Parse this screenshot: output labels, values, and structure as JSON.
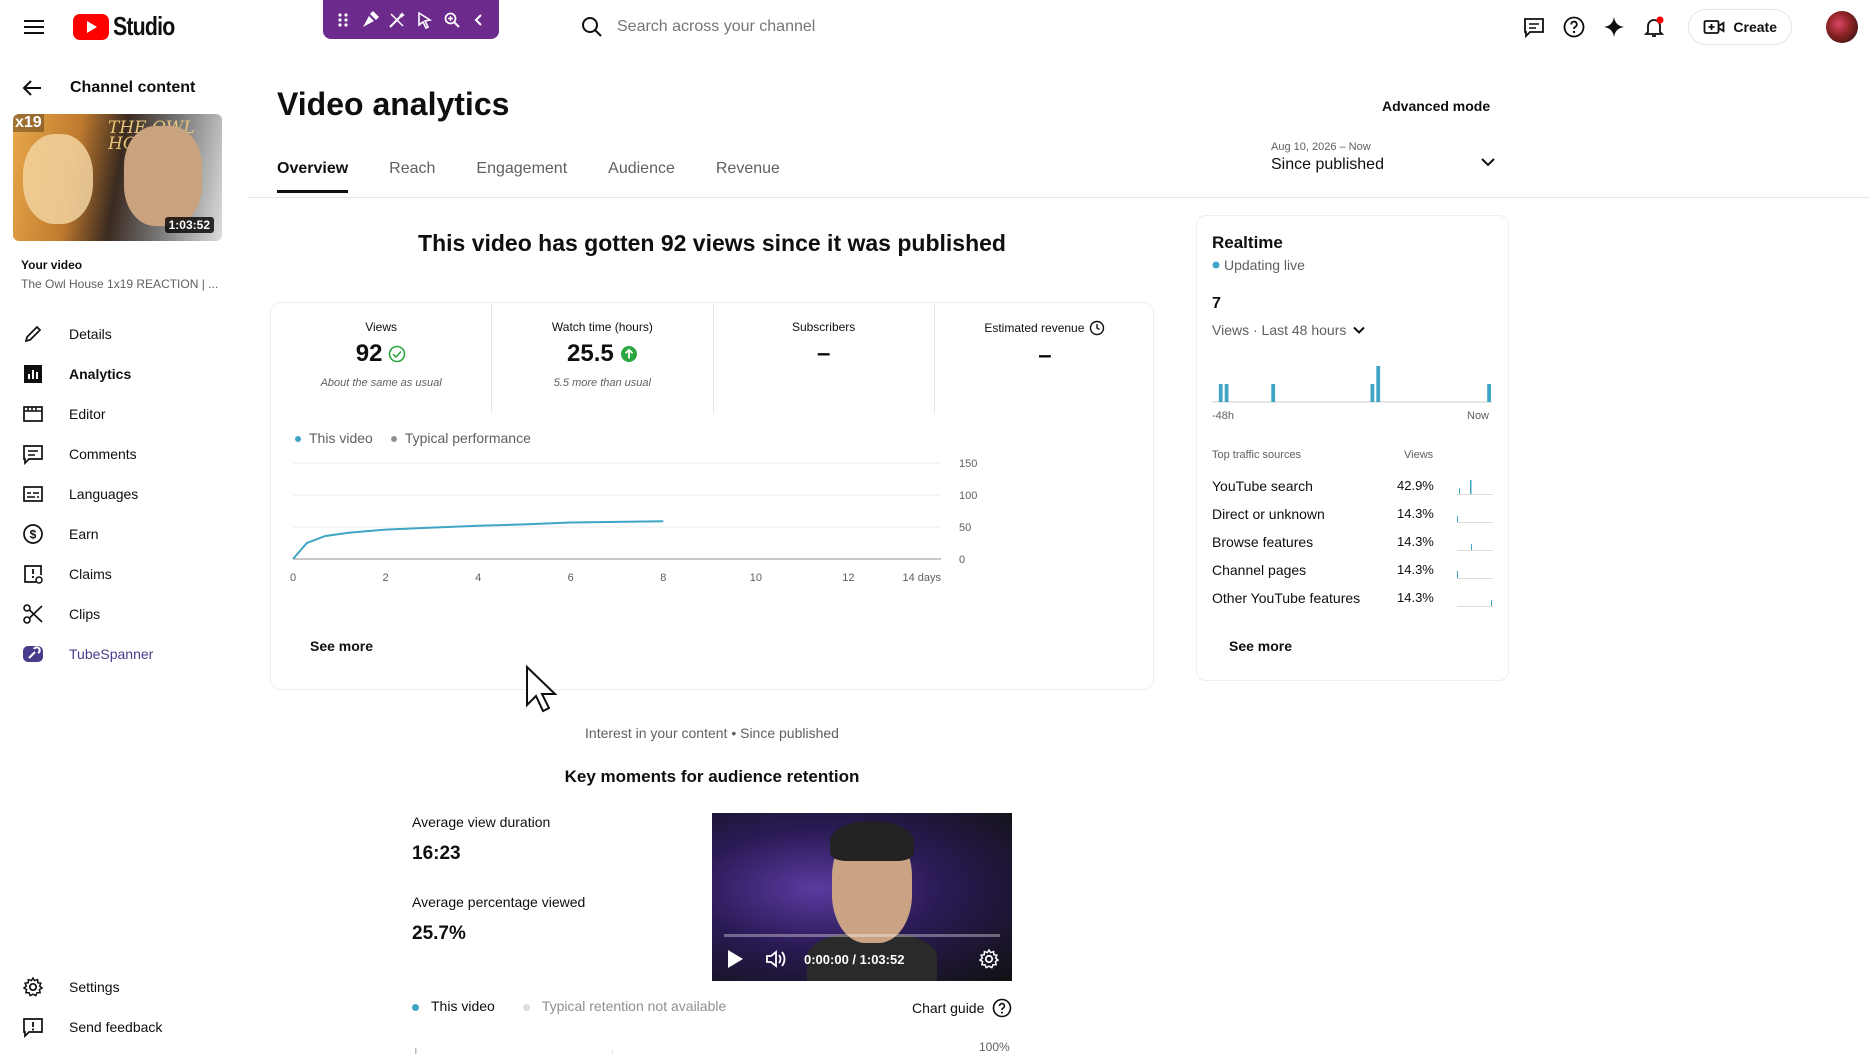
{
  "header": {
    "app_name": "Studio",
    "search_placeholder": "Search across your channel",
    "create_label": "Create"
  },
  "sidebar": {
    "back_label": "Channel content",
    "thumbnail": {
      "episode_badge": "x19",
      "duration": "1:03:52",
      "art_text": "THE OWL HOUSE"
    },
    "your_video_label": "Your video",
    "video_title": "The Owl House 1x19 REACTION | ...",
    "items": [
      {
        "label": "Details",
        "icon": "pencil-icon"
      },
      {
        "label": "Analytics",
        "icon": "analytics-icon"
      },
      {
        "label": "Editor",
        "icon": "editor-icon"
      },
      {
        "label": "Comments",
        "icon": "comments-icon"
      },
      {
        "label": "Languages",
        "icon": "subtitles-icon"
      },
      {
        "label": "Earn",
        "icon": "dollar-icon"
      },
      {
        "label": "Claims",
        "icon": "claims-icon"
      },
      {
        "label": "Clips",
        "icon": "scissors-icon"
      },
      {
        "label": "TubeSpanner",
        "icon": "tubespanner-icon"
      }
    ],
    "bottom_items": [
      {
        "label": "Settings",
        "icon": "gear-icon"
      },
      {
        "label": "Send feedback",
        "icon": "feedback-icon"
      }
    ]
  },
  "main": {
    "title": "Video analytics",
    "advanced_mode": "Advanced mode",
    "tabs": [
      "Overview",
      "Reach",
      "Engagement",
      "Audience",
      "Revenue"
    ],
    "date_range": "Aug 10, 2026 – Now",
    "date_value": "Since published",
    "headline": "This video has gotten 92 views since it was published",
    "metrics": [
      {
        "label": "Views",
        "value": "92",
        "sub": "About the same as usual",
        "status": "same"
      },
      {
        "label": "Watch time (hours)",
        "value": "25.5",
        "sub": "5.5 more than usual",
        "status": "up"
      },
      {
        "label": "Subscribers",
        "value": "–",
        "sub": "",
        "status": "none"
      },
      {
        "label": "Estimated revenue",
        "value": "–",
        "sub": "",
        "status": "none"
      }
    ],
    "legend": {
      "this_video": "This video",
      "typical": "Typical performance"
    },
    "see_more": "See more"
  },
  "chart_data": {
    "type": "line",
    "series": [
      {
        "name": "This video",
        "color": "#3ea6c4",
        "x": [
          0,
          0.3,
          0.7,
          1.2,
          2,
          3,
          4,
          5,
          6,
          7,
          8
        ],
        "y": [
          0,
          25,
          36,
          41,
          46,
          49,
          52,
          54,
          57,
          58,
          59
        ]
      }
    ],
    "xticks": [
      "0",
      "2",
      "4",
      "6",
      "8",
      "10",
      "12",
      "14 days"
    ],
    "yticks": [
      "150",
      "100",
      "50",
      "0"
    ],
    "xlim": [
      0,
      14
    ],
    "ylim": [
      0,
      150
    ],
    "grid": true
  },
  "realtime": {
    "title": "Realtime",
    "live_label": "Updating live",
    "count": "7",
    "period": "Views · Last 48 hours",
    "axis_start": "-48h",
    "axis_end": "Now",
    "bars_hourly": [
      0,
      2,
      2,
      0,
      0,
      0,
      0,
      0,
      0,
      0,
      2,
      0,
      0,
      0,
      0,
      0,
      0,
      0,
      0,
      0,
      0,
      0,
      0,
      0,
      0,
      0,
      0,
      2,
      4,
      0,
      0,
      0,
      0,
      0,
      0,
      0,
      0,
      0,
      0,
      0,
      0,
      0,
      0,
      0,
      0,
      0,
      0,
      2
    ],
    "sources_title": "Top traffic sources",
    "views_col": "Views",
    "sources": [
      {
        "name": "YouTube search",
        "pct": "42.9%"
      },
      {
        "name": "Direct or unknown",
        "pct": "14.3%"
      },
      {
        "name": "Browse features",
        "pct": "14.3%"
      },
      {
        "name": "Channel pages",
        "pct": "14.3%"
      },
      {
        "name": "Other YouTube features",
        "pct": "14.3%"
      }
    ],
    "see_more": "See more"
  },
  "retention": {
    "interest_label": "Interest in your content • Since published",
    "title": "Key moments for audience retention",
    "avd_label": "Average view duration",
    "avd_value": "16:23",
    "apv_label": "Average percentage viewed",
    "apv_value": "25.7%",
    "player_time": "0:00:00 / 1:03:52",
    "legend_this": "This video",
    "legend_typical": "Typical retention not available",
    "chart_guide": "Chart guide",
    "y_top": "100%"
  },
  "colors": {
    "accent_blue": "#3ea6c4",
    "brand_red": "#ff0000",
    "ext_purple": "#6b2a8c",
    "up_green": "#2ba640"
  }
}
